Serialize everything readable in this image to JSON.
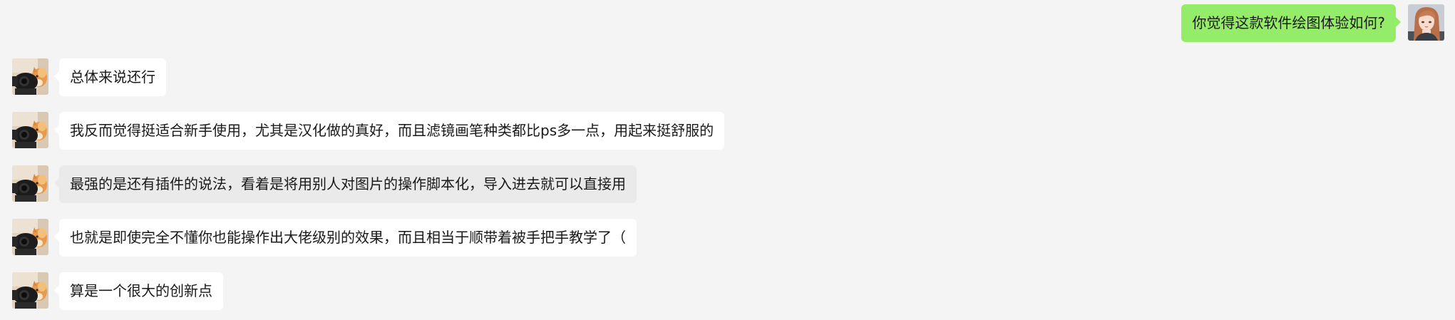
{
  "conversation": {
    "outgoing": {
      "text": "你觉得这款软件绘图体验如何?"
    },
    "incoming": [
      {
        "text": "总体来说还行",
        "highlighted": false
      },
      {
        "text": "我反而觉得挺适合新手使用，尤其是汉化做的真好，而且滤镜画笔种类都比ps多一点，用起来挺舒服的",
        "highlighted": false
      },
      {
        "text": "最强的是还有插件的说法，看着是将用别人对图片的操作脚本化，导入进去就可以直接用",
        "highlighted": true
      },
      {
        "text": "也就是即使完全不懂你也能操作出大佬级别的效果，而且相当于顺带着被手把手教学了（",
        "highlighted": false
      },
      {
        "text": "算是一个很大的创新点",
        "highlighted": false
      }
    ]
  },
  "colors": {
    "background": "#f4f4f4",
    "outgoing_bubble": "#95ec69",
    "incoming_bubble": "#ffffff",
    "highlighted_bubble": "#eaeaea"
  },
  "icons": {
    "self_avatar": "anime-girl-avatar",
    "contact_avatar": "cat-photo-avatar"
  }
}
